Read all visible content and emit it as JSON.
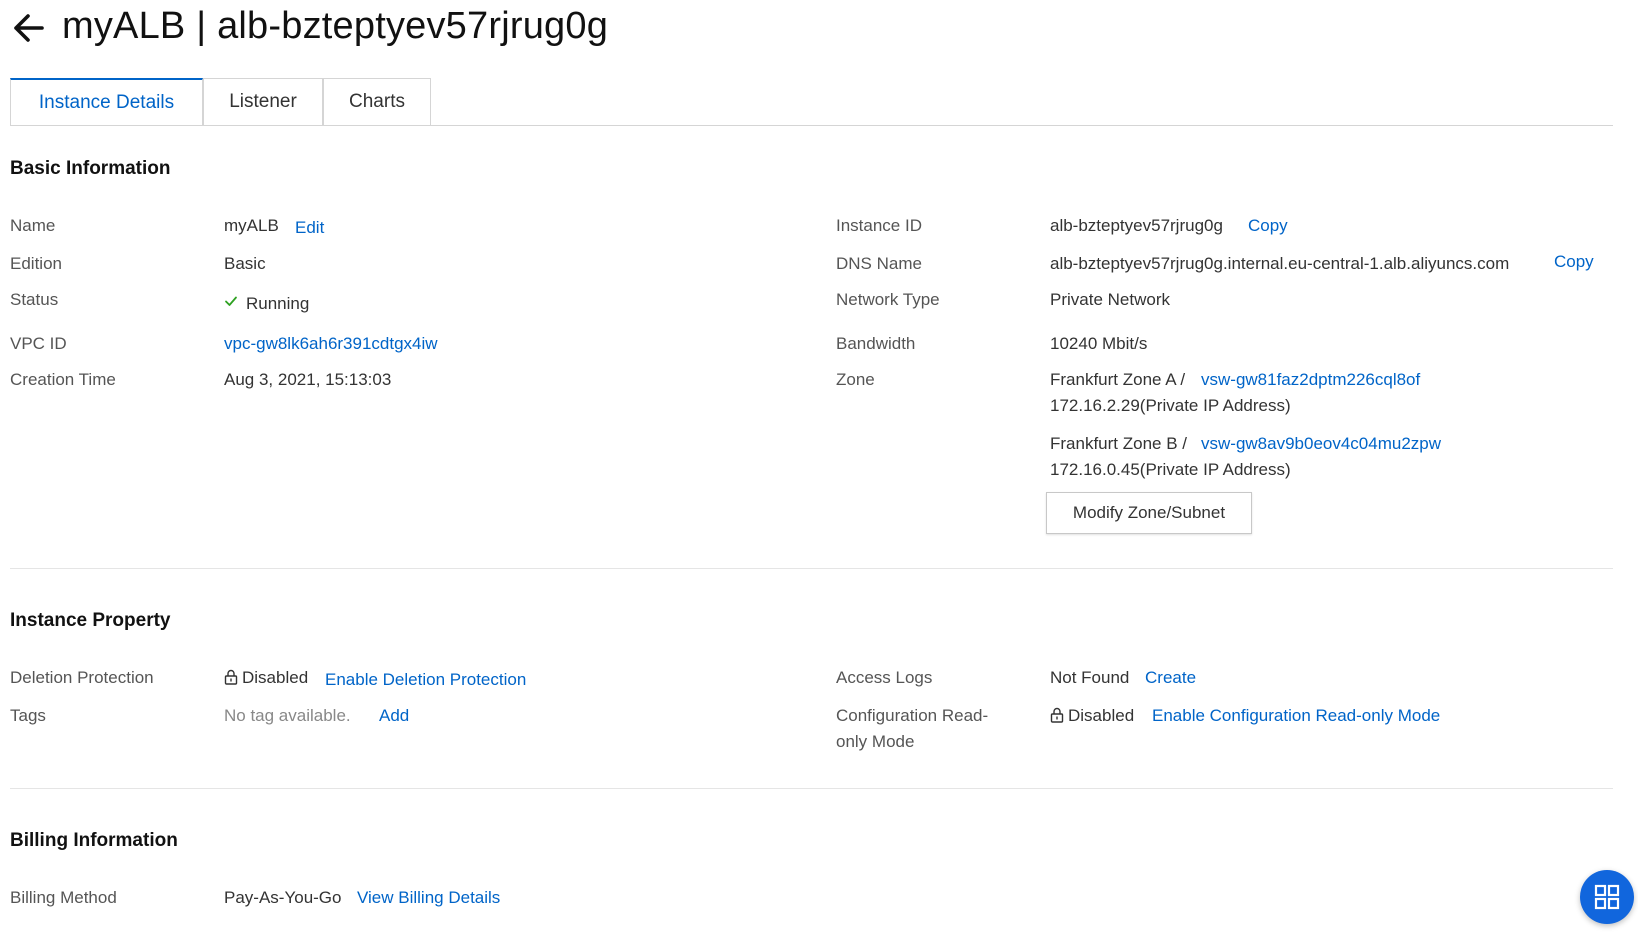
{
  "header": {
    "title": "myALB | alb-bzteptyev57rjrug0g"
  },
  "tabs": [
    {
      "label": "Instance Details",
      "active": true
    },
    {
      "label": "Listener",
      "active": false
    },
    {
      "label": "Charts",
      "active": false
    }
  ],
  "basic": {
    "title": "Basic Information",
    "name_label": "Name",
    "name_value": "myALB",
    "name_edit": "Edit",
    "edition_label": "Edition",
    "edition_value": "Basic",
    "status_label": "Status",
    "status_value": "Running",
    "vpc_label": "VPC ID",
    "vpc_value": "vpc-gw8lk6ah6r391cdtgx4iw",
    "creation_label": "Creation Time",
    "creation_value": "Aug 3, 2021, 15:13:03",
    "instance_id_label": "Instance ID",
    "instance_id_value": "alb-bzteptyev57rjrug0g",
    "instance_id_copy": "Copy",
    "dns_label": "DNS Name",
    "dns_value": "alb-bzteptyev57rjrug0g.internal.eu-central-1.alb.aliyuncs.com",
    "dns_copy": "Copy",
    "network_label": "Network Type",
    "network_value": "Private Network",
    "bandwidth_label": "Bandwidth",
    "bandwidth_value": "10240 Mbit/s",
    "zone_label": "Zone",
    "zones": [
      {
        "name": "Frankfurt Zone A /",
        "vswitch": "vsw-gw81faz2dptm226cql8of",
        "ip": "172.16.2.29(Private IP Address)"
      },
      {
        "name": "Frankfurt Zone B /",
        "vswitch": "vsw-gw8av9b0eov4c04mu2zpw",
        "ip": "172.16.0.45(Private IP Address)"
      }
    ],
    "modify_button": "Modify Zone/Subnet"
  },
  "property": {
    "title": "Instance Property",
    "deletion_label": "Deletion Protection",
    "deletion_value": "Disabled",
    "deletion_link": "Enable Deletion Protection",
    "tags_label": "Tags",
    "tags_value": "No tag available.",
    "tags_link": "Add",
    "access_logs_label": "Access Logs",
    "access_logs_value": "Not Found",
    "access_logs_link": "Create",
    "config_label_line1": "Configuration Read-",
    "config_label_line2": "only Mode",
    "config_value": "Disabled",
    "config_link": "Enable Configuration Read-only Mode"
  },
  "billing": {
    "title": "Billing Information",
    "method_label": "Billing Method",
    "method_value": "Pay-As-You-Go",
    "method_link": "View Billing Details"
  },
  "icons": {
    "back": "arrow-left-icon",
    "status": "check-icon",
    "lock": "lock-icon",
    "fab": "grid-icon"
  },
  "colors": {
    "accent": "#0064c8",
    "success": "#2ea121",
    "fab": "#1166dd"
  }
}
